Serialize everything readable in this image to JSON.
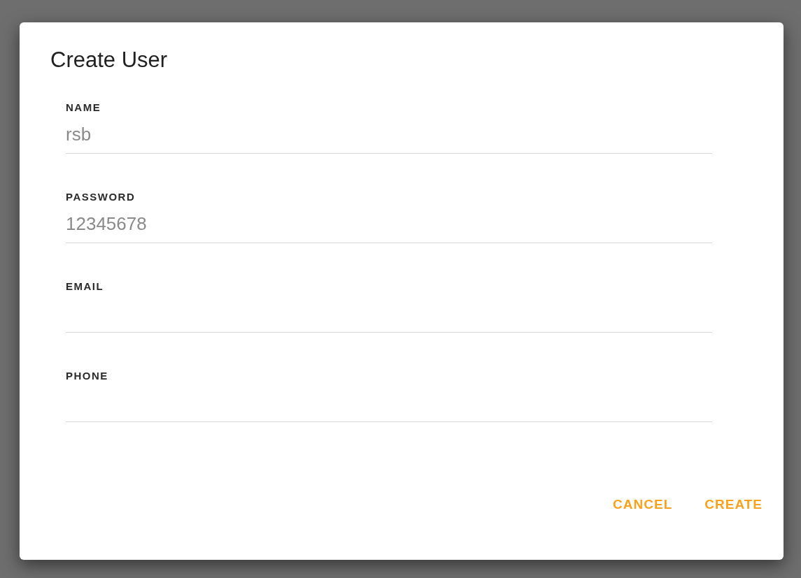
{
  "dialog": {
    "title": "Create User",
    "fields": [
      {
        "label": "NAME",
        "value": "rsb"
      },
      {
        "label": "PASSWORD",
        "value": "12345678"
      },
      {
        "label": "EMAIL"
      },
      {
        "label": "PHONE"
      }
    ],
    "buttons": [
      "CANCEL",
      "CREATE"
    ]
  }
}
